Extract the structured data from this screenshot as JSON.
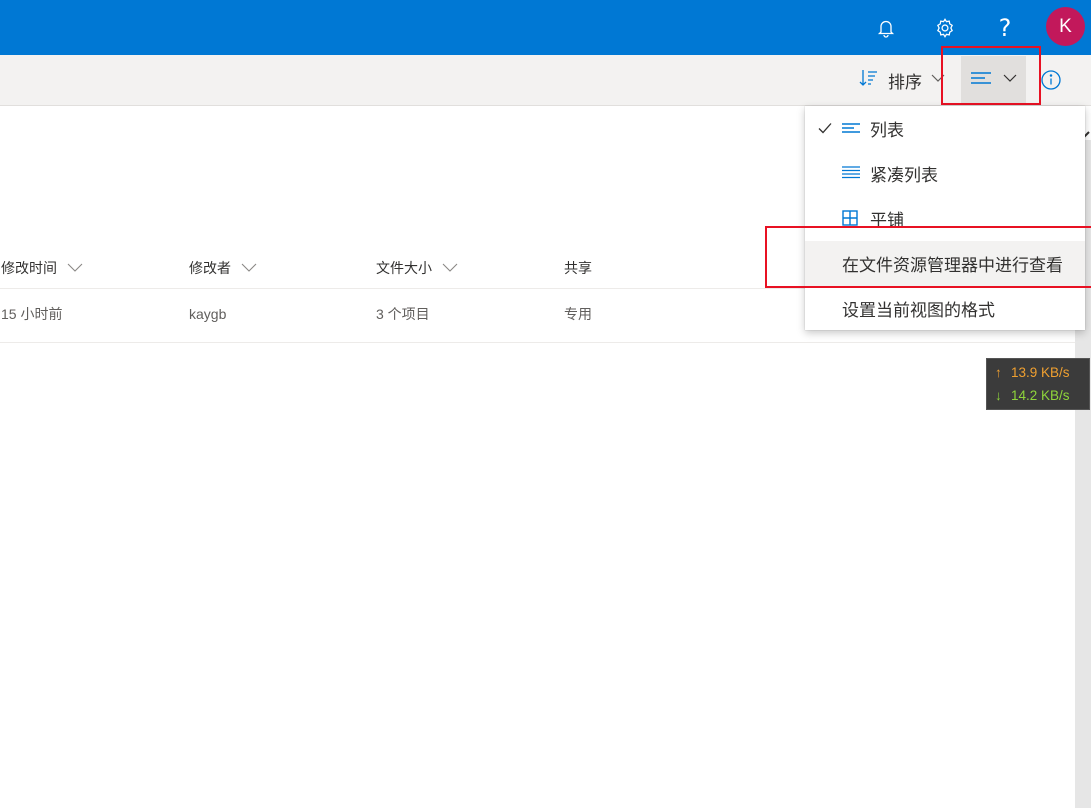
{
  "suite_bar": {
    "color": "#0078d4",
    "icons": [
      "bell-icon",
      "gear-icon",
      "help-icon"
    ],
    "help_glyph": "?",
    "avatar_initial": "K",
    "avatar_color": "#c2185b"
  },
  "command_bar": {
    "sort_label": "排序",
    "view_icon": "list-view-icon",
    "info_icon": "info-icon"
  },
  "table": {
    "columns": [
      "修改时间",
      "修改者",
      "文件大小",
      "共享"
    ],
    "rows": [
      [
        "15 小时前",
        "kaygb",
        "3 个项目",
        "专用"
      ]
    ]
  },
  "view_menu": {
    "items": [
      {
        "label": "列表",
        "icon": "list-icon",
        "checked": true
      },
      {
        "label": "紧凑列表",
        "icon": "compact-list-icon",
        "checked": false
      },
      {
        "label": "平铺",
        "icon": "tiles-icon",
        "checked": false
      },
      {
        "label": "在文件资源管理器中进行查看",
        "icon": "",
        "checked": false
      },
      {
        "label": "设置当前视图的格式",
        "icon": "",
        "checked": false
      }
    ]
  },
  "net_monitor": {
    "upload": "13.9 KB/s",
    "download": "14.2 KB/s",
    "upload_arrow": "↑",
    "download_arrow": "↓",
    "upload_color": "#f0a030",
    "download_color": "#8fd63b"
  }
}
